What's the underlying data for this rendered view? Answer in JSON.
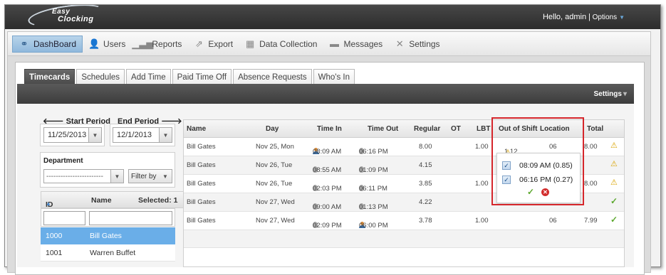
{
  "topbar": {
    "logo_word1": "Easy",
    "logo_word2": "Clocking",
    "greeting": "Hello, admin |",
    "options_label": "Options"
  },
  "mainnav": {
    "items": [
      {
        "label": "DashBoard",
        "icon": "dashboard-icon"
      },
      {
        "label": "Users",
        "icon": "user-icon"
      },
      {
        "label": "Reports",
        "icon": "bar-chart-icon"
      },
      {
        "label": "Export",
        "icon": "export-icon"
      },
      {
        "label": "Data Collection",
        "icon": "calendar-icon"
      },
      {
        "label": "Messages",
        "icon": "message-icon"
      },
      {
        "label": "Settings",
        "icon": "wrench-icon"
      }
    ]
  },
  "subtabs": [
    "Timecards",
    "Schedules",
    "Add Time",
    "Paid Time Off",
    "Absence Requests",
    "Who's In"
  ],
  "toolbar": {
    "settings_label": "Settings"
  },
  "period": {
    "start_label": "Start Period",
    "end_label": "End Period",
    "start_value": "11/25/2013",
    "end_value": "12/1/2013"
  },
  "department": {
    "label": "Department",
    "value": "------------------------",
    "filter_label": "Filter by"
  },
  "employees": {
    "id_header": "ID #",
    "name_header": "Name",
    "selected_label": "Selected: 1",
    "rows": [
      {
        "id": "1000",
        "name": "Bill Gates"
      },
      {
        "id": "1001",
        "name": "Warren Buffet"
      }
    ]
  },
  "grid": {
    "headers": {
      "name": "Name",
      "day": "Day",
      "time_in": "Time In",
      "time_out": "Time Out",
      "regular": "Regular",
      "ot": "OT",
      "lbt": "LBT",
      "out_of_shift": "Out of Shift",
      "location": "Location",
      "total": "Total"
    },
    "rows": [
      {
        "name": "Bill Gates",
        "day": "Nov 25, Mon",
        "time_in": "08:09 AM",
        "time_out": "06:16 PM",
        "regular": "8.00",
        "lbt": "1.00",
        "out_of_shift": "1.12",
        "location": "06",
        "total": "8.00"
      },
      {
        "name": "Bill Gates",
        "day": "Nov 26, Tue",
        "time_in": "08:55 AM",
        "time_out": "01:09 PM",
        "regular": "4.15",
        "lbt": "",
        "out_of_shift": "",
        "location": "",
        "total": ""
      },
      {
        "name": "Bill Gates",
        "day": "Nov 26, Tue",
        "time_in": "02:03 PM",
        "time_out": "06:11 PM",
        "regular": "3.85",
        "lbt": "1.00",
        "out_of_shift": "",
        "location": "",
        "total": "8.00"
      },
      {
        "name": "Bill Gates",
        "day": "Nov 27, Wed",
        "time_in": "09:00 AM",
        "time_out": "01:13 PM",
        "regular": "4.22",
        "lbt": "",
        "out_of_shift": "",
        "location": "",
        "total": ""
      },
      {
        "name": "Bill Gates",
        "day": "Nov 27, Wed",
        "time_in": "02:09 PM",
        "time_out": "06:00 PM",
        "regular": "3.78",
        "lbt": "1.00",
        "out_of_shift": "",
        "location": "06",
        "total": "7.99"
      }
    ]
  },
  "popup": {
    "item1": "08:09 AM (0.85)",
    "item2": "06:16 PM (0.27)"
  },
  "colors": {
    "accent": "#6aaee8",
    "highlight": "#d5262b",
    "warning": "#d9a300",
    "ok": "#5ca82e"
  }
}
